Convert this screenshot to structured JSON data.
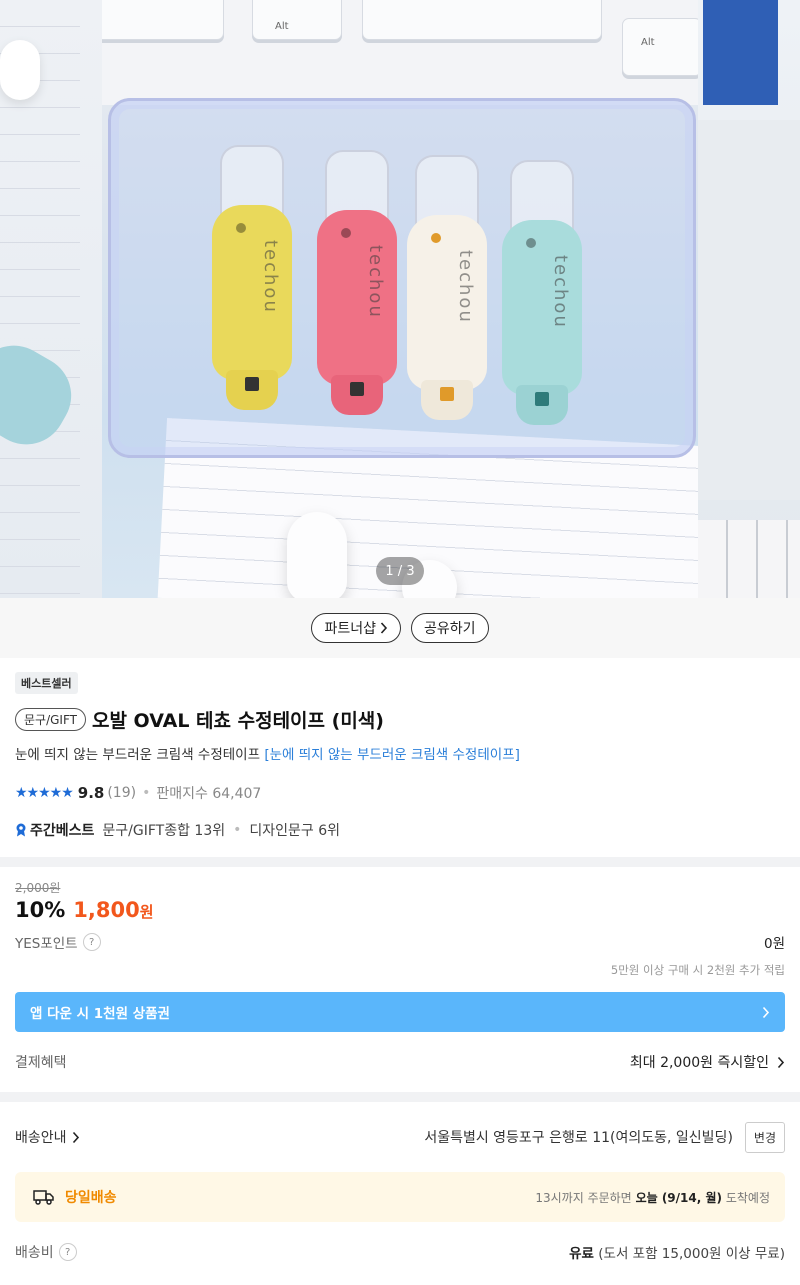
{
  "gallery": {
    "page_indicator": "1 / 3",
    "key_labels": [
      "Alt",
      "Alt"
    ],
    "tape_labels": [
      "techou",
      "techou",
      "techou",
      "techou"
    ],
    "tape_colors": [
      "#e9d95b",
      "#ef7185",
      "#f6f1e8",
      "#a9dcdc"
    ]
  },
  "share_bar": {
    "partner_label": "파트너샵",
    "share_label": "공유하기"
  },
  "product": {
    "best_badge": "베스트셀러",
    "category": "문구/GIFT",
    "title": "오발 OVAL 테쵸 수정테이프 (미색)",
    "subtitle_plain": "눈에 띄지 않는 부드러운 크림색 수정테이프",
    "subtitle_link": "[눈에 띄지 않는 부드러운 크림색 수정테이프]",
    "stars": "★★★★★",
    "rating": "9.8",
    "review_count": "(19)",
    "dot": "•",
    "sales_label": "판매지수 64,407",
    "weekly_best_label": "주간베스트",
    "rank_1": "문구/GIFT종합 13위",
    "rank_sep": "•",
    "rank_2": "디자인문구 6위"
  },
  "price": {
    "original": "2,000원",
    "discount": "10%",
    "sale_amount": "1,800",
    "sale_unit": "원",
    "points_label": "YES포인트",
    "points_help": "?",
    "points_value": "0원",
    "points_note": "5만원 이상 구매 시 2천원 추가 적립",
    "app_banner": "앱 다운 시 1천원 상품권",
    "benefit_label": "결제혜택",
    "benefit_value": "최대 2,000원 즉시할인"
  },
  "delivery": {
    "label": "배송안내",
    "address": "서울특별시 영등포구 은행로 11(여의도동, 일신빌딩)",
    "change_label": "변경",
    "sameday_label": "당일배송",
    "sameday_prefix": "13시까지 주문하면",
    "sameday_date": "오늘 (9/14, 월)",
    "sameday_suffix": "도착예정",
    "fee_label": "배송비",
    "fee_help": "?",
    "fee_bold": "유료",
    "fee_note": "(도서 포함 15,000원 이상 무료)"
  }
}
